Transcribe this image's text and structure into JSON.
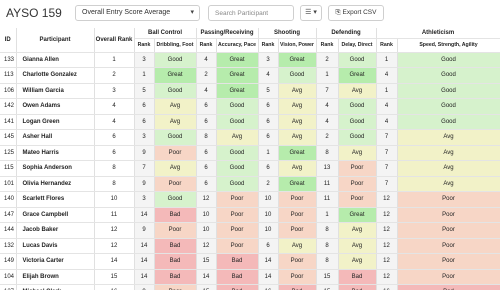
{
  "header": {
    "title": "AYSO 159",
    "select_value": "Overall Entry Score Average",
    "search_placeholder": "Search Participant",
    "list_icon": "list-icon",
    "export_label": "Export CSV"
  },
  "columns": {
    "id": "ID",
    "participant": "Participant",
    "overall_rank": "Overall Rank",
    "groups": [
      "Ball Control",
      "Passing/Receiving",
      "Shooting",
      "Defending",
      "Athleticism"
    ],
    "rank": "Rank",
    "sub": [
      "Dribbling, Foot",
      "Accuracy, Pace",
      "Vision, Power",
      "Delay, Direct",
      "Speed, Strength, Agility"
    ]
  },
  "rows": [
    {
      "id": "133",
      "name": "Gianna Allen",
      "overall": "1",
      "cells": [
        [
          "3",
          "Good"
        ],
        [
          "4",
          "Great"
        ],
        [
          "3",
          "Great"
        ],
        [
          "2",
          "Good"
        ],
        [
          "1",
          "Good"
        ]
      ]
    },
    {
      "id": "113",
      "name": "Charlotte Gonzalez",
      "overall": "2",
      "cells": [
        [
          "1",
          "Great"
        ],
        [
          "2",
          "Great"
        ],
        [
          "4",
          "Good"
        ],
        [
          "1",
          "Great"
        ],
        [
          "4",
          "Good"
        ]
      ]
    },
    {
      "id": "106",
      "name": "William Garcia",
      "overall": "3",
      "cells": [
        [
          "5",
          "Good"
        ],
        [
          "4",
          "Great"
        ],
        [
          "5",
          "Avg"
        ],
        [
          "7",
          "Avg"
        ],
        [
          "1",
          "Good"
        ]
      ]
    },
    {
      "id": "142",
      "name": "Owen Adams",
      "overall": "4",
      "cells": [
        [
          "6",
          "Avg"
        ],
        [
          "6",
          "Good"
        ],
        [
          "6",
          "Avg"
        ],
        [
          "4",
          "Good"
        ],
        [
          "4",
          "Good"
        ]
      ]
    },
    {
      "id": "141",
      "name": "Logan Green",
      "overall": "4",
      "cells": [
        [
          "6",
          "Avg"
        ],
        [
          "6",
          "Good"
        ],
        [
          "6",
          "Avg"
        ],
        [
          "4",
          "Good"
        ],
        [
          "4",
          "Good"
        ]
      ]
    },
    {
      "id": "145",
      "name": "Asher Hall",
      "overall": "6",
      "cells": [
        [
          "3",
          "Good"
        ],
        [
          "8",
          "Avg"
        ],
        [
          "6",
          "Avg"
        ],
        [
          "2",
          "Good"
        ],
        [
          "7",
          "Avg"
        ]
      ]
    },
    {
      "id": "125",
      "name": "Mateo Harris",
      "overall": "6",
      "cells": [
        [
          "9",
          "Poor"
        ],
        [
          "6",
          "Good"
        ],
        [
          "1",
          "Great"
        ],
        [
          "8",
          "Avg"
        ],
        [
          "7",
          "Avg"
        ]
      ]
    },
    {
      "id": "115",
      "name": "Sophia Anderson",
      "overall": "8",
      "cells": [
        [
          "7",
          "Avg"
        ],
        [
          "6",
          "Good"
        ],
        [
          "6",
          "Avg"
        ],
        [
          "13",
          "Poor"
        ],
        [
          "7",
          "Avg"
        ]
      ]
    },
    {
      "id": "101",
      "name": "Olivia Hernandez",
      "overall": "8",
      "cells": [
        [
          "9",
          "Poor"
        ],
        [
          "6",
          "Good"
        ],
        [
          "2",
          "Great"
        ],
        [
          "11",
          "Poor"
        ],
        [
          "7",
          "Avg"
        ]
      ]
    },
    {
      "id": "140",
      "name": "Scarlett Flores",
      "overall": "10",
      "cells": [
        [
          "3",
          "Good"
        ],
        [
          "12",
          "Poor"
        ],
        [
          "10",
          "Poor"
        ],
        [
          "11",
          "Poor"
        ],
        [
          "12",
          "Poor"
        ]
      ]
    },
    {
      "id": "147",
      "name": "Grace Campbell",
      "overall": "11",
      "cells": [
        [
          "14",
          "Bad"
        ],
        [
          "10",
          "Poor"
        ],
        [
          "10",
          "Poor"
        ],
        [
          "1",
          "Great"
        ],
        [
          "12",
          "Poor"
        ]
      ]
    },
    {
      "id": "144",
      "name": "Jacob Baker",
      "overall": "12",
      "cells": [
        [
          "9",
          "Poor"
        ],
        [
          "10",
          "Poor"
        ],
        [
          "10",
          "Poor"
        ],
        [
          "8",
          "Avg"
        ],
        [
          "12",
          "Poor"
        ]
      ]
    },
    {
      "id": "132",
      "name": "Lucas Davis",
      "overall": "12",
      "cells": [
        [
          "14",
          "Bad"
        ],
        [
          "12",
          "Poor"
        ],
        [
          "6",
          "Avg"
        ],
        [
          "8",
          "Avg"
        ],
        [
          "12",
          "Poor"
        ]
      ]
    },
    {
      "id": "149",
      "name": "Victoria Carter",
      "overall": "14",
      "cells": [
        [
          "14",
          "Bad"
        ],
        [
          "15",
          "Bad"
        ],
        [
          "14",
          "Poor"
        ],
        [
          "8",
          "Avg"
        ],
        [
          "12",
          "Poor"
        ]
      ]
    },
    {
      "id": "104",
      "name": "Elijah Brown",
      "overall": "15",
      "cells": [
        [
          "14",
          "Bad"
        ],
        [
          "14",
          "Bad"
        ],
        [
          "14",
          "Poor"
        ],
        [
          "15",
          "Bad"
        ],
        [
          "12",
          "Poor"
        ]
      ]
    },
    {
      "id": "127",
      "name": "Michael Clark",
      "overall": "16",
      "cells": [
        [
          "9",
          "Poor"
        ],
        [
          "15",
          "Bad"
        ],
        [
          "16",
          "Bad"
        ],
        [
          "15",
          "Bad"
        ],
        [
          "16",
          "Bad"
        ]
      ]
    }
  ],
  "colors": {
    "Great": "#b6ecac",
    "Good": "#d6f2cc",
    "Avg": "#f2f2c8",
    "Poor": "#f7d6c6",
    "Bad": "#f4b9b9",
    "rank_bg": "#f4f4f4"
  }
}
